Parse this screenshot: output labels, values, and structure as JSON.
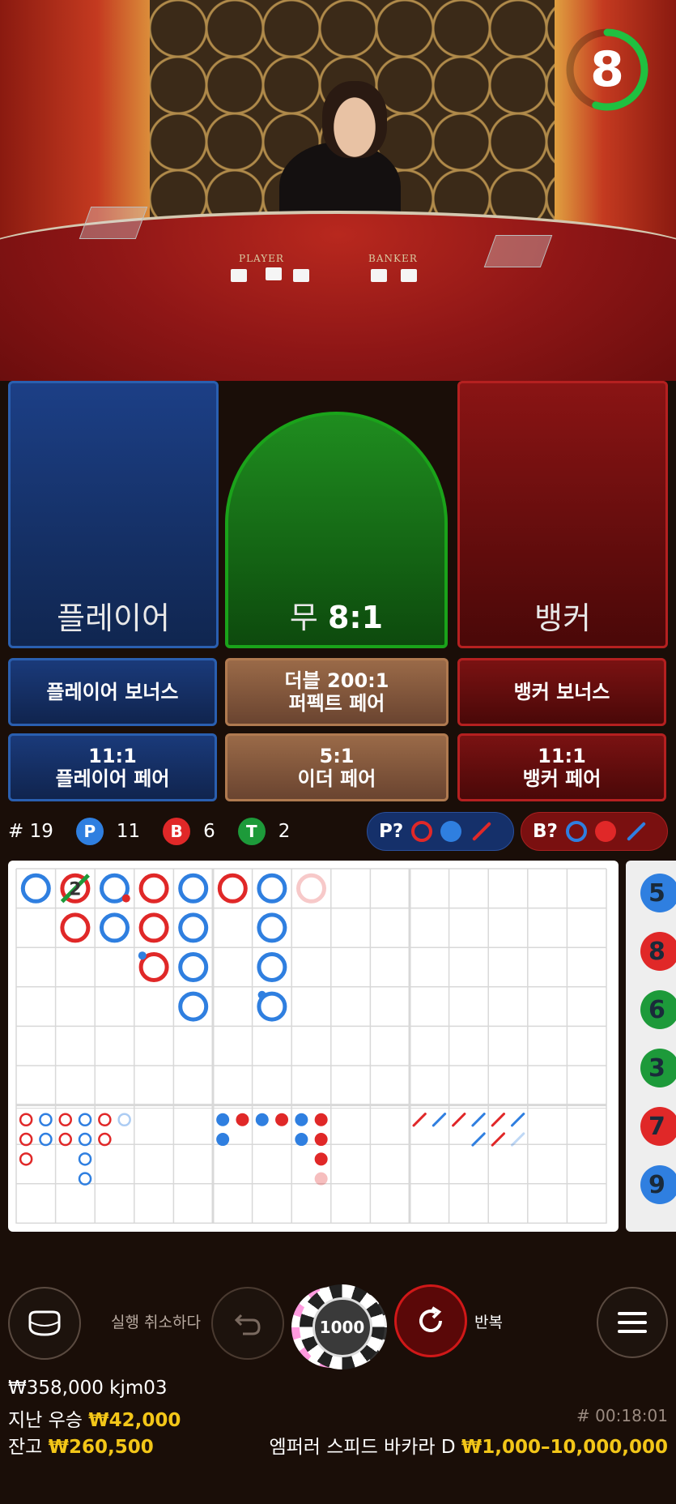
{
  "timer": {
    "value": "8",
    "fraction_remaining": 0.55
  },
  "table_labels": {
    "player": "PLAYER",
    "banker": "BANKER"
  },
  "bets": {
    "player": "플레이어",
    "tie_label": "무",
    "tie_odds": "8:1",
    "banker": "뱅커",
    "player_bonus": "플레이어 보너스",
    "perfect_pair": "더블 200:1\n퍼펙트 페어",
    "banker_bonus": "뱅커 보너스",
    "player_pair": "11:1\n플레이어 페어",
    "either_pair": "5:1\n이더 페어",
    "banker_pair": "11:1\n뱅커 페어"
  },
  "stats": {
    "round": "# 19",
    "player_letter": "P",
    "player_count": "11",
    "banker_letter": "B",
    "banker_count": "6",
    "tie_letter": "T",
    "tie_count": "2"
  },
  "predictions": {
    "player": "P?",
    "banker": "B?"
  },
  "colors": {
    "player": "#2f7fe0",
    "banker": "#e02828",
    "tie": "#1d9a3a",
    "gold": "#f3c618",
    "timer": "#20c040"
  },
  "roadmap_side": [
    "5",
    "8",
    "6",
    "3",
    "7",
    "9"
  ],
  "big_road_tie_count": "2",
  "controls": {
    "undo_label": "실행 취소하다",
    "chip_value": "1000",
    "repeat_label": "반복"
  },
  "footer": {
    "total_bet": "₩358,000 kjm03",
    "last_win_label": "지난 우승",
    "last_win_value": "₩42,000",
    "balance_label": "잔고",
    "balance_value": "₩260,500",
    "game_id": "# 00:18:01",
    "table_name": "엠퍼러 스피드 바카라 D",
    "limits": "₩1,000–10,000,000"
  }
}
